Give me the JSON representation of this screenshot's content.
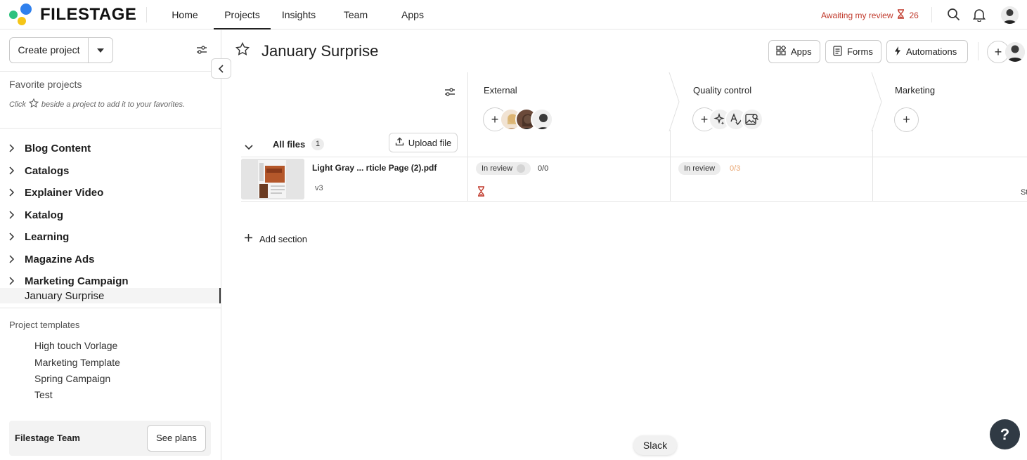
{
  "nav": {
    "brand": "FILESTAGE",
    "items": [
      {
        "label": "Home"
      },
      {
        "label": "Projects",
        "active": true
      },
      {
        "label": "Insights"
      },
      {
        "label": "Team"
      },
      {
        "label": "Apps"
      }
    ],
    "awaiting_label": "Awaiting my review",
    "awaiting_count": "26",
    "icons": [
      "search-icon",
      "bell-icon",
      "user-avatar"
    ]
  },
  "sidebar": {
    "create_label": "Create project",
    "favorites_title": "Favorite projects",
    "favorites_hint_pre": "Click",
    "favorites_hint_post": "beside a project to add it to your favorites.",
    "projects": [
      {
        "name": "Blog Content"
      },
      {
        "name": "Catalogs"
      },
      {
        "name": "Explainer Video"
      },
      {
        "name": "Katalog"
      },
      {
        "name": "Learning"
      },
      {
        "name": "Magazine Ads"
      },
      {
        "name": "Marketing Campaign"
      },
      {
        "name": "January Surprise",
        "active": true
      }
    ],
    "templates_title": "Project templates",
    "templates": [
      {
        "name": "High touch Vorlage"
      },
      {
        "name": "Marketing Template"
      },
      {
        "name": "Spring Campaign"
      },
      {
        "name": "Test"
      }
    ],
    "team_name": "Filestage Team",
    "see_plans_label": "See plans"
  },
  "main": {
    "title": "January Surprise",
    "header_buttons": {
      "apps": "Apps",
      "forms": "Forms",
      "automations": "Automations"
    },
    "steps": [
      {
        "name": "External"
      },
      {
        "name": "Quality control"
      },
      {
        "name": "Marketing"
      }
    ],
    "section": {
      "name": "All files",
      "count": "1",
      "upload_label": "Upload file"
    },
    "file": {
      "name": "Light Gray ...   rticle Page (2).pdf",
      "version": "v3",
      "external_status": "In review",
      "external_ratio": "0/0",
      "qc_status": "In review",
      "qc_ratio": "0/3",
      "marketing_partial": "St"
    },
    "add_section_label": "Add section"
  },
  "tooltip": "Slack",
  "help_label": "?",
  "colors": {
    "accent_red": "#c0392b",
    "help_bg": "#303a44",
    "logo_green": "#2ec27e",
    "logo_blue": "#2f80ed",
    "logo_yellow": "#f5c518"
  }
}
